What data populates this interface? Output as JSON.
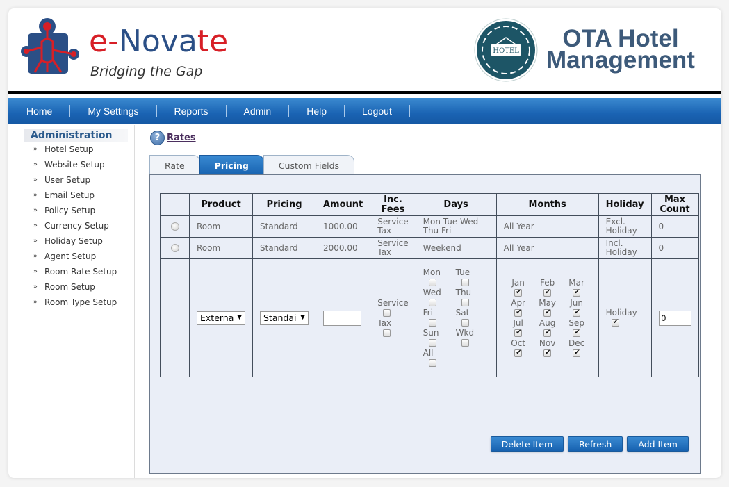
{
  "header": {
    "brand_prefix": "e-",
    "brand_main": "Nova",
    "brand_t": "t",
    "brand_e": "e",
    "tagline": "Bridging the Gap",
    "badge_text": "HOTEL",
    "product_title_line1": "OTA Hotel",
    "product_title_line2": "Management"
  },
  "nav": {
    "items": [
      {
        "label": "Home"
      },
      {
        "label": "My Settings"
      },
      {
        "label": "Reports"
      },
      {
        "label": "Admin"
      },
      {
        "label": "Help"
      },
      {
        "label": "Logout"
      }
    ]
  },
  "sidebar": {
    "title": "Administration",
    "bullet": "»",
    "items": [
      {
        "label": "Hotel Setup"
      },
      {
        "label": "Website Setup"
      },
      {
        "label": "User Setup"
      },
      {
        "label": "Email Setup"
      },
      {
        "label": "Policy Setup"
      },
      {
        "label": "Currency Setup"
      },
      {
        "label": "Holiday Setup"
      },
      {
        "label": "Agent Setup"
      },
      {
        "label": "Room Rate Setup"
      },
      {
        "label": "Room Setup"
      },
      {
        "label": "Room Type Setup"
      }
    ]
  },
  "main": {
    "help_icon": "?",
    "page_link": "Rates",
    "tabs": [
      {
        "label": "Rate",
        "active": false
      },
      {
        "label": "Pricing",
        "active": true
      },
      {
        "label": "Custom Fields",
        "active": false
      }
    ],
    "table": {
      "headers": [
        "",
        "Product",
        "Pricing",
        "Amount",
        "Inc. Fees",
        "Days",
        "Months",
        "Holiday",
        "Max Count"
      ],
      "rows": [
        {
          "product": "Room",
          "pricing": "Standard",
          "amount": "1000.00",
          "fees": "Service Tax",
          "days": "Mon Tue Wed Thu Fri",
          "months": "All Year",
          "holiday": "Excl. Holiday",
          "max_count": "0"
        },
        {
          "product": "Room",
          "pricing": "Standard",
          "amount": "2000.00",
          "fees": "Service Tax",
          "days": "Weekend",
          "months": "All Year",
          "holiday": "Incl. Holiday",
          "max_count": "0"
        }
      ],
      "new_row": {
        "product_select": "Externa",
        "pricing_select": "Standai",
        "amount_value": "",
        "fees": [
          {
            "label": "Service",
            "checked": false
          },
          {
            "label": "Tax",
            "checked": false
          }
        ],
        "days": [
          {
            "label": "Mon",
            "checked": false
          },
          {
            "label": "Tue",
            "checked": false
          },
          {
            "label": "Wed",
            "checked": false
          },
          {
            "label": "Thu",
            "checked": false
          },
          {
            "label": "Fri",
            "checked": false
          },
          {
            "label": "Sat",
            "checked": false
          },
          {
            "label": "Sun",
            "checked": false
          },
          {
            "label": "Wkd",
            "checked": false
          },
          {
            "label": "All",
            "checked": false
          }
        ],
        "months": [
          {
            "label": "Jan",
            "checked": true
          },
          {
            "label": "Feb",
            "checked": true
          },
          {
            "label": "Mar",
            "checked": true
          },
          {
            "label": "Apr",
            "checked": true
          },
          {
            "label": "May",
            "checked": true
          },
          {
            "label": "Jun",
            "checked": true
          },
          {
            "label": "Jul",
            "checked": true
          },
          {
            "label": "Aug",
            "checked": true
          },
          {
            "label": "Sep",
            "checked": true
          },
          {
            "label": "Oct",
            "checked": true
          },
          {
            "label": "Nov",
            "checked": true
          },
          {
            "label": "Dec",
            "checked": true
          }
        ],
        "holiday": {
          "label": "Holiday",
          "checked": true
        },
        "max_count_value": "0"
      }
    },
    "buttons": {
      "delete": "Delete Item",
      "refresh": "Refresh",
      "add": "Add Item"
    }
  }
}
